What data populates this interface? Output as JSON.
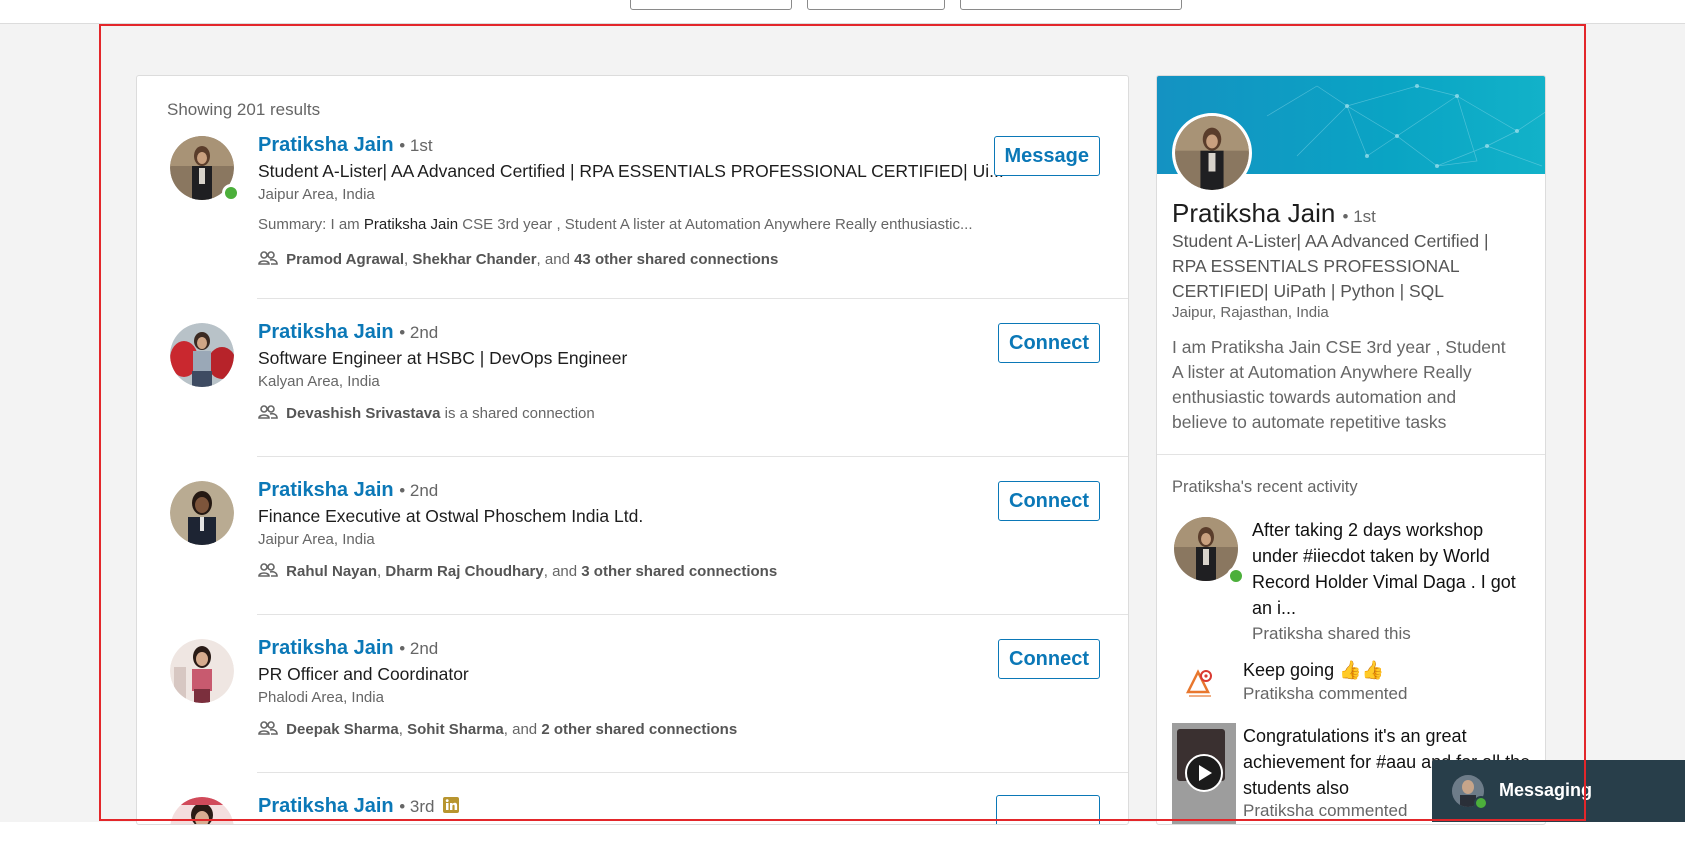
{
  "results": {
    "count_text": "Showing 201 results",
    "items": [
      {
        "name": "Pratiksha Jain",
        "degree": "• 1st",
        "headline": "Student A-Lister| AA Advanced Certified | RPA ESSENTIALS PROFESSIONAL CERTIFIED| Ui...",
        "location": "Jaipur Area, India",
        "summary_prefix": "Summary: I am",
        "summary_name": "Pratiksha Jain",
        "summary_suffix": "CSE 3rd year , Student A lister at Automation Anywhere Really enthusiastic...",
        "shared_a": "Pramod Agrawal",
        "shared_sep1": ",",
        "shared_b": "Shekhar Chander",
        "shared_mid": ", and",
        "shared_c": "43 other shared connections",
        "action": "Message"
      },
      {
        "name": "Pratiksha Jain",
        "degree": "• 2nd",
        "headline": "Software Engineer at HSBC | DevOps Engineer",
        "location": "Kalyan Area, India",
        "shared_a": "Devashish Srivastava",
        "shared_tail": "is a shared connection",
        "action": "Connect"
      },
      {
        "name": "Pratiksha Jain",
        "degree": "• 2nd",
        "headline": "Finance Executive at Ostwal Phoschem India Ltd.",
        "location": "Jaipur Area, India",
        "shared_a": "Rahul Nayan",
        "shared_sep1": ",",
        "shared_b": "Dharm Raj Choudhary",
        "shared_mid": ", and",
        "shared_c": "3 other shared connections",
        "action": "Connect"
      },
      {
        "name": "Pratiksha Jain",
        "degree": "• 2nd",
        "headline": "PR Officer and Coordinator",
        "location": "Phalodi Area, India",
        "shared_a": "Deepak Sharma",
        "shared_sep1": ",",
        "shared_b": "Sohit Sharma",
        "shared_mid": ", and",
        "shared_c": "2 other shared connections",
        "action": "Connect"
      },
      {
        "name": "Pratiksha Jain",
        "degree": "• 3rd",
        "badge_icon": "linkedin-premium-icon"
      }
    ]
  },
  "profile": {
    "name": "Pratiksha Jain",
    "degree": "• 1st",
    "headline": "Student A-Lister| AA Advanced Certified | RPA ESSENTIALS PROFESSIONAL CERTIFIED| UiPath | Python | SQL",
    "location": "Jaipur, Rajasthan, India",
    "summary": "I am Pratiksha Jain CSE 3rd year , Student A lister at Automation Anywhere Really enthusiastic towards automation and believe to automate repetitive tasks",
    "activity_heading": "Pratiksha's recent activity",
    "activities": [
      {
        "title": "After taking 2 days workshop under #iiecdot taken by World Record Holder Vimal Daga . I got an i...",
        "sub": "Pratiksha shared this"
      },
      {
        "title": "Keep going 👍👍",
        "sub": "Pratiksha commented"
      },
      {
        "title": "Congratulations it's an great achievement for #aau and for all the students also",
        "sub": "Pratiksha commented"
      }
    ]
  },
  "messaging": {
    "label": "Messaging"
  },
  "colors": {
    "accent": "#0b78b7",
    "online": "#4caf3b",
    "highlight": "#e3262a",
    "messaging_bg": "#283e4a"
  }
}
